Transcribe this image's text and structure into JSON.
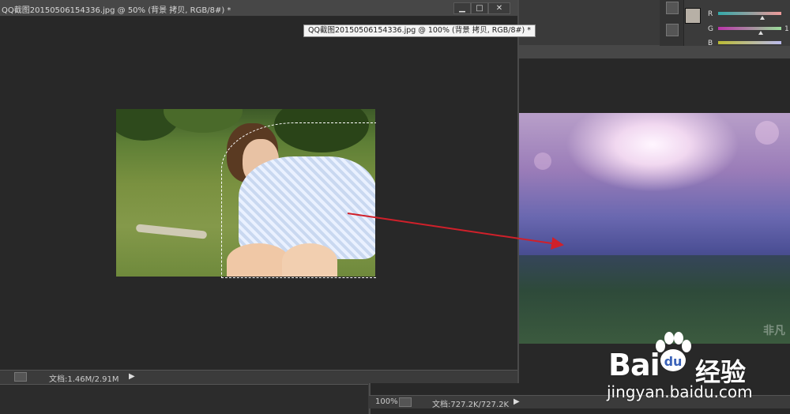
{
  "window1": {
    "title": "QQ截图20150506154336.jpg @ 50% (背景 拷贝, RGB/8#) *",
    "buttons": {
      "minimize": "▁",
      "maximize": "□",
      "close": "✕"
    },
    "doc_info": "文档:1.46M/2.91M"
  },
  "tooltip": "QQ截图20150506154336.jpg @ 100% (背景 拷贝, RGB/8#) *",
  "window2": {
    "zoom": "100%",
    "doc_info": "文档:727.2K/727.2K"
  },
  "color_panel": {
    "channels": [
      "R",
      "G",
      "B"
    ],
    "value_partial": "1"
  },
  "watermark": {
    "brand_left": "Bai",
    "brand_right": "经验",
    "url": "jingyan.baidu.com"
  },
  "colors": {
    "arrow": "#d0202a",
    "canvas_bg": "#282828",
    "titlebar": "#474747"
  }
}
